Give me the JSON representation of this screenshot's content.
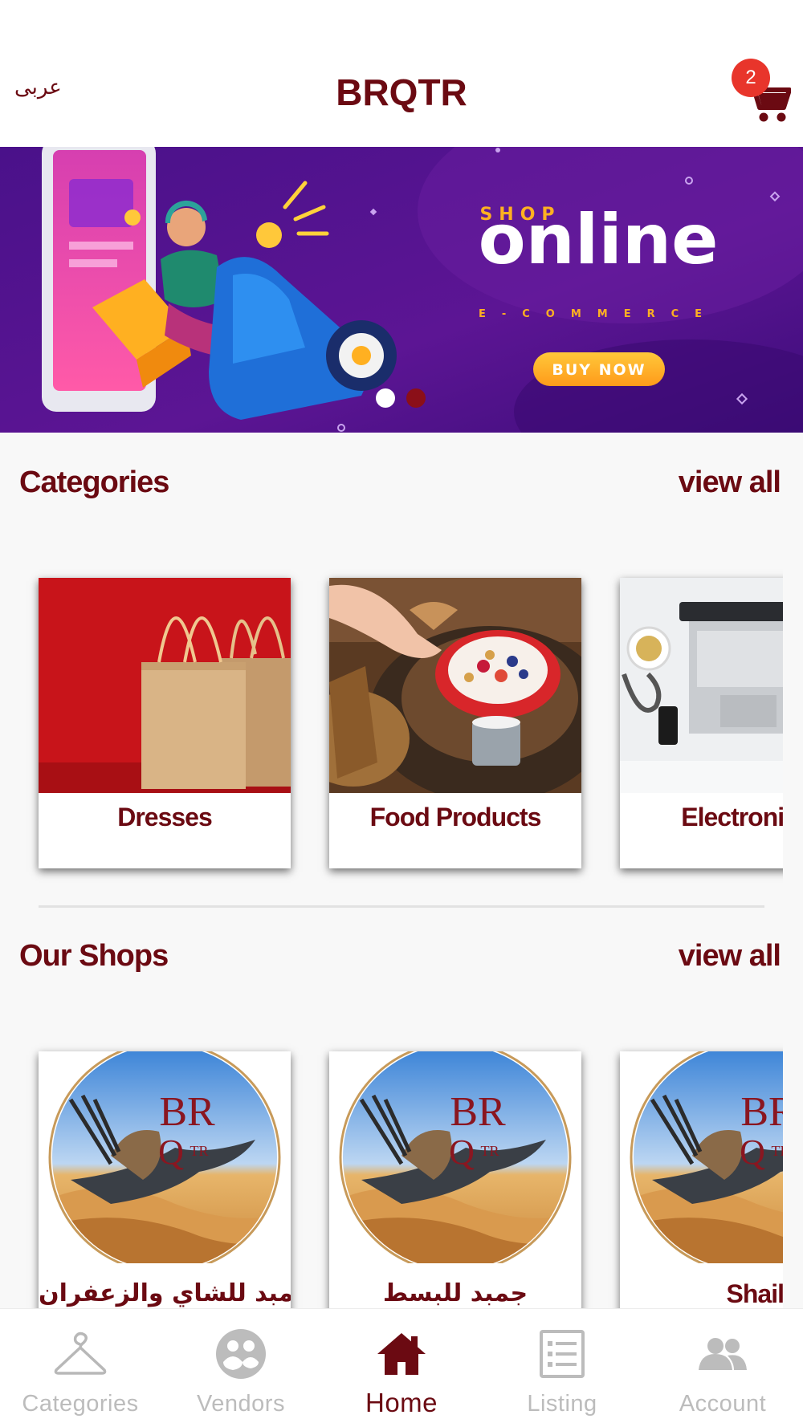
{
  "header": {
    "language_toggle": "عربى",
    "app_title": "BRQTR",
    "cart_badge": "2"
  },
  "banner": {
    "shop_label": "SHOP",
    "headline": "online",
    "subline": "E-COMMERCE",
    "cta": "BUY NOW",
    "slides": 2,
    "active_slide": 1
  },
  "categories": {
    "title": "Categories",
    "view_all": "view all",
    "items": [
      {
        "label": "Dresses",
        "image": "shopping-bags"
      },
      {
        "label": "Food Products",
        "image": "breakfast-bowl"
      },
      {
        "label": "Electronics",
        "image": "laptop-desk"
      }
    ]
  },
  "shops": {
    "title": "Our Shops",
    "view_all": "view all",
    "logo_text": [
      "BR",
      "Q",
      "TR"
    ],
    "items": [
      {
        "label": "جمبد للشاي والزعفران"
      },
      {
        "label": "جمبد للبسط"
      },
      {
        "label": "Shail"
      }
    ]
  },
  "tabbar": {
    "items": [
      {
        "label": "Categories",
        "icon": "hanger-icon",
        "active": false
      },
      {
        "label": "Vendors",
        "icon": "vendors-icon",
        "active": false
      },
      {
        "label": "Home",
        "icon": "home-icon",
        "active": true
      },
      {
        "label": "Listing",
        "icon": "listing-icon",
        "active": false
      },
      {
        "label": "Account",
        "icon": "account-icon",
        "active": false
      }
    ]
  },
  "colors": {
    "brand": "#6b0a12",
    "badge": "#e8352b",
    "banner_bg": "#5b128f",
    "inactive_tab": "#bcbcbc"
  }
}
